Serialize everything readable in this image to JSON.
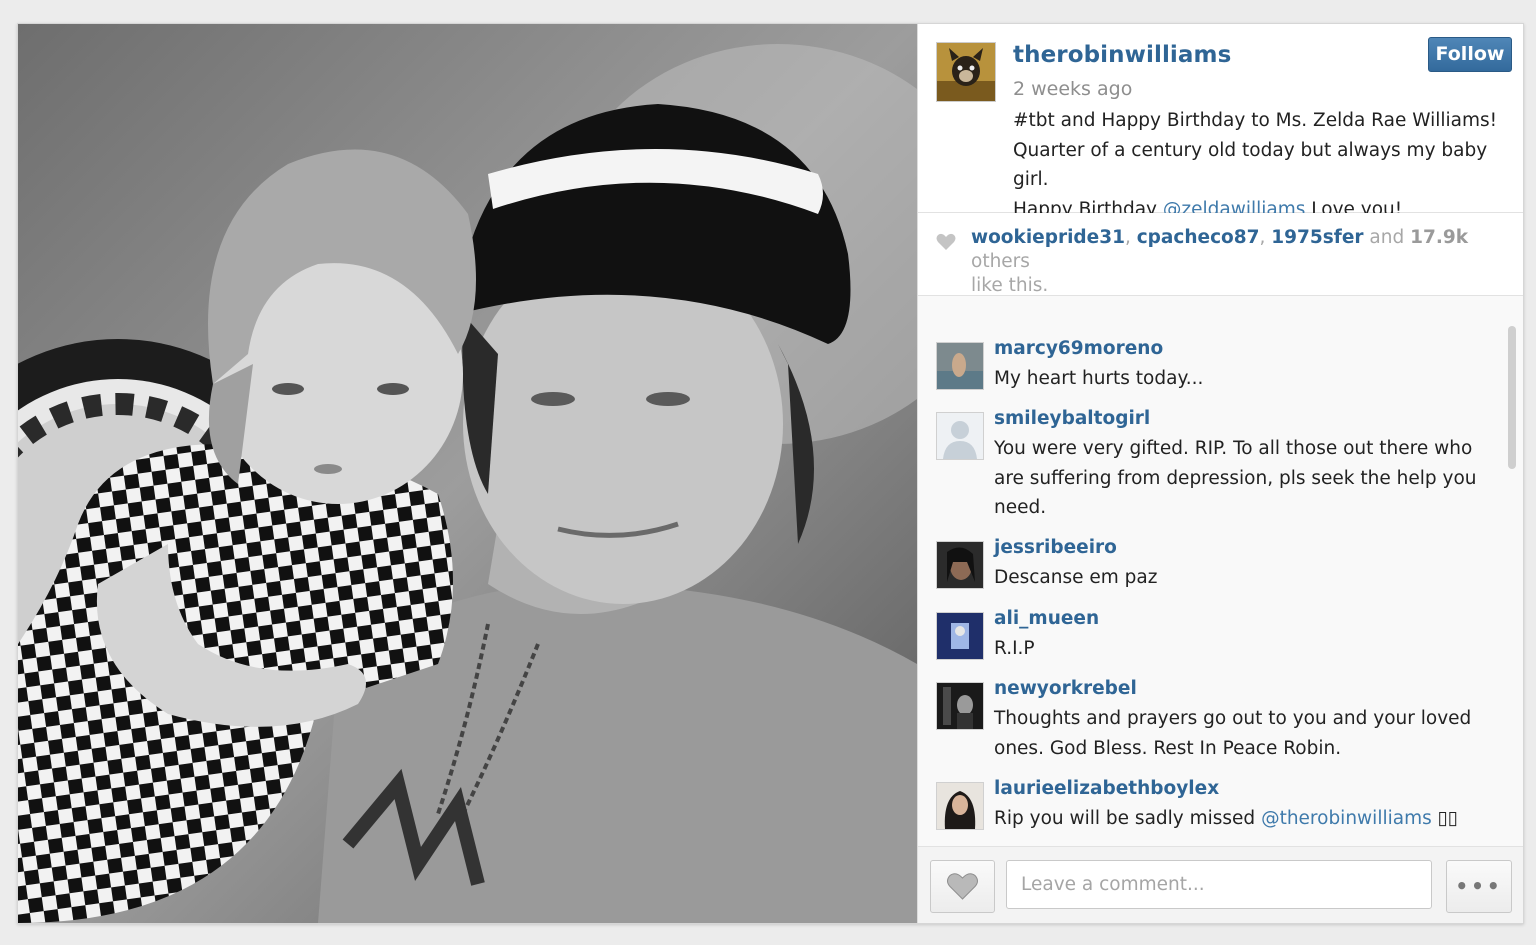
{
  "post": {
    "username": "therobinwilliams",
    "timestamp": "2 weeks ago",
    "follow_label": "Follow",
    "caption_line1": "#tbt and Happy Birthday to Ms. Zelda Rae Williams!",
    "caption_line2": "Quarter of a century old today but always my baby girl.",
    "caption_line3_prefix": "Happy Birthday ",
    "caption_mention": "@zeldawilliams",
    "caption_line3_suffix": " Love you!"
  },
  "likes": {
    "user1": "wookiepride31",
    "sep1": ", ",
    "user2": "cpacheco87",
    "sep2": ", ",
    "user3": "1975sfer",
    "and": " and ",
    "count": "17.9k",
    "others": " others",
    "tail": "like this."
  },
  "comments": [
    {
      "user": "marcy69moreno",
      "text": "My heart hurts today..."
    },
    {
      "user": "smileybaltogirl",
      "text": "You were very gifted. RIP. To all those out there who are suffering from depression, pls seek the help you need."
    },
    {
      "user": "jessribeeiro",
      "text": "Descanse em paz"
    },
    {
      "user": "ali_mueen",
      "text": "R.I.P"
    },
    {
      "user": "newyorkrebel",
      "text": "Thoughts and prayers go out to you and your loved ones. God Bless. Rest In Peace Robin."
    },
    {
      "user": "laurieelizabethboylex",
      "text_prefix": "Rip you will be sadly missed ",
      "mention": "@therobinwilliams",
      "text_suffix": " ▯▯"
    }
  ],
  "footer": {
    "comment_placeholder": "Leave a comment...",
    "more_label": "•••"
  },
  "colors": {
    "username": "#2f6595",
    "follow_button": "#3f76a8",
    "mention": "#3f7aab"
  }
}
